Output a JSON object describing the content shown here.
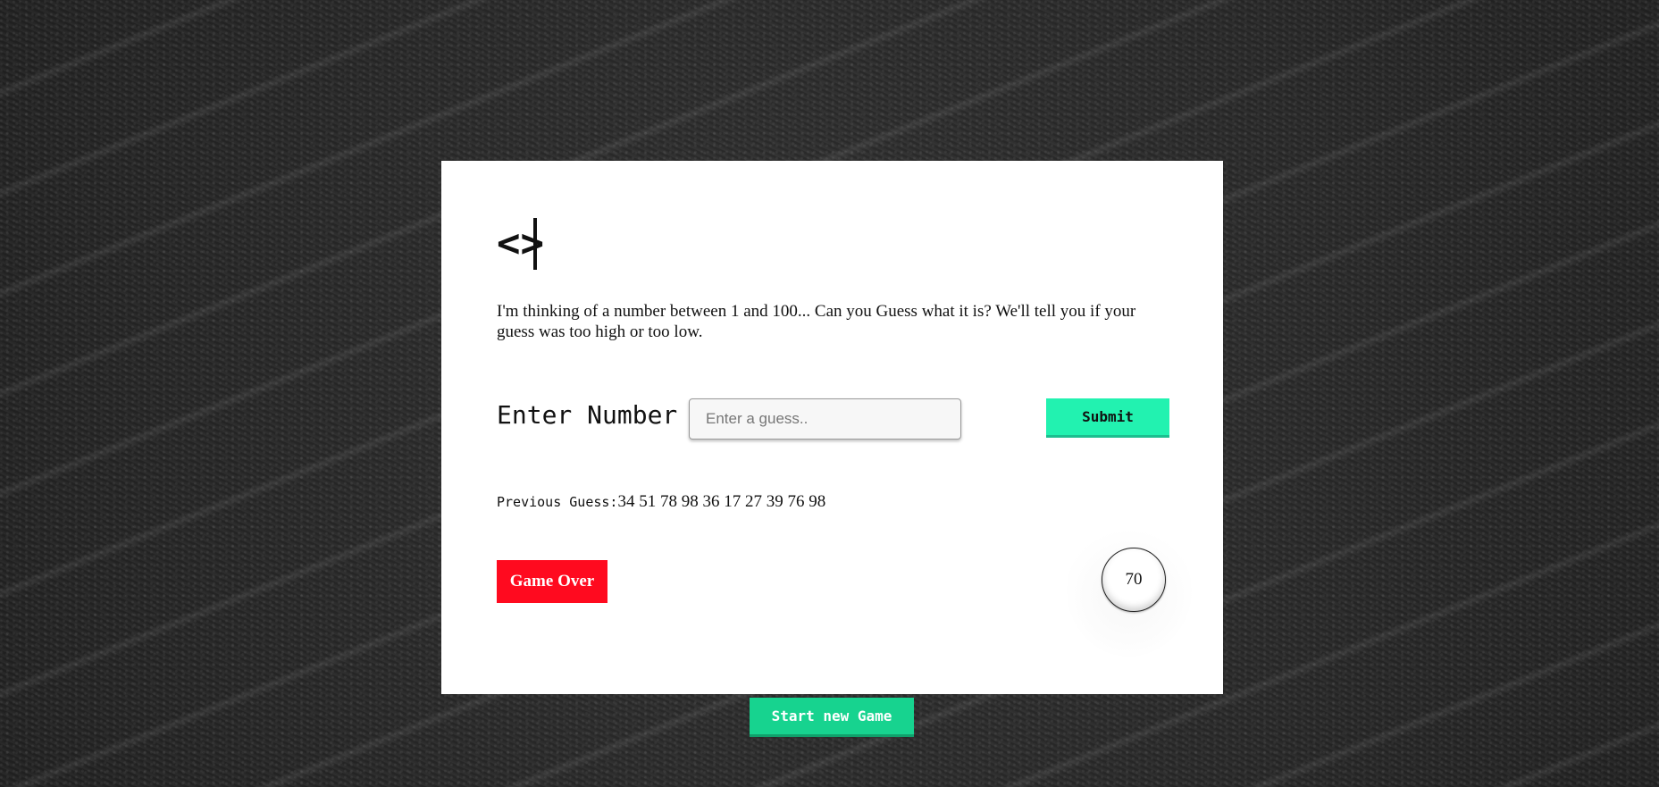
{
  "logo": {
    "glyph": "<>",
    "icon": "code-brackets-icon"
  },
  "intro": {
    "text": "I'm thinking of a number between 1 and 100... Can you Guess what it is? We'll tell you if your guess was too high or too low."
  },
  "guess_form": {
    "label": "Enter Number",
    "input_value": "",
    "input_placeholder": "Enter a guess..",
    "submit_label": "Submit"
  },
  "previous": {
    "label": "Previous Guess:",
    "values": "34 51 78 98 36 17 27 39 76 98"
  },
  "status": {
    "message": "Game Over",
    "remaining": "70"
  },
  "new_game": {
    "label": "Start new Game"
  },
  "colors": {
    "submit": "#22f2b0",
    "game_over": "#ff0a1f",
    "new_game": "#17d38f",
    "card": "#ffffff"
  }
}
